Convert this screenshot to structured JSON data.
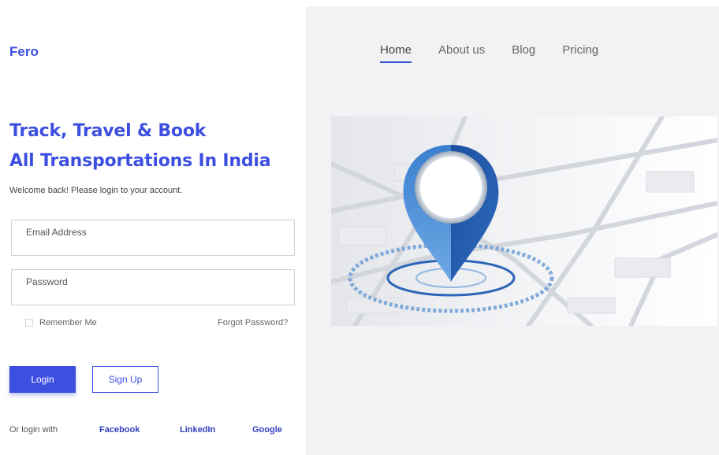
{
  "brand": {
    "logo": "Fero",
    "accent_color": "#3d4fe0"
  },
  "hero_text": {
    "line1": "Track, Travel & Book",
    "line2": "All Transportations In India",
    "welcome": "Welcome  back! Please login to your account."
  },
  "form": {
    "email_label": "Email Address",
    "email_value": "",
    "password_label": "Password",
    "password_value": "",
    "remember_label": "Remember Me",
    "remember_checked": false,
    "forgot_label": "Forgot Password?",
    "login_label": "Login",
    "signup_label": "Sign Up"
  },
  "social": {
    "prefix": "Or login with",
    "facebook": "Facebook",
    "linkedin": "LinkedIn",
    "google": "Google"
  },
  "nav": {
    "items": [
      {
        "label": "Home",
        "active": true
      },
      {
        "label": "About us",
        "active": false
      },
      {
        "label": "Blog",
        "active": false
      },
      {
        "label": "Pricing",
        "active": false
      }
    ]
  },
  "illustration": {
    "icon": "map-location-pin-icon"
  }
}
